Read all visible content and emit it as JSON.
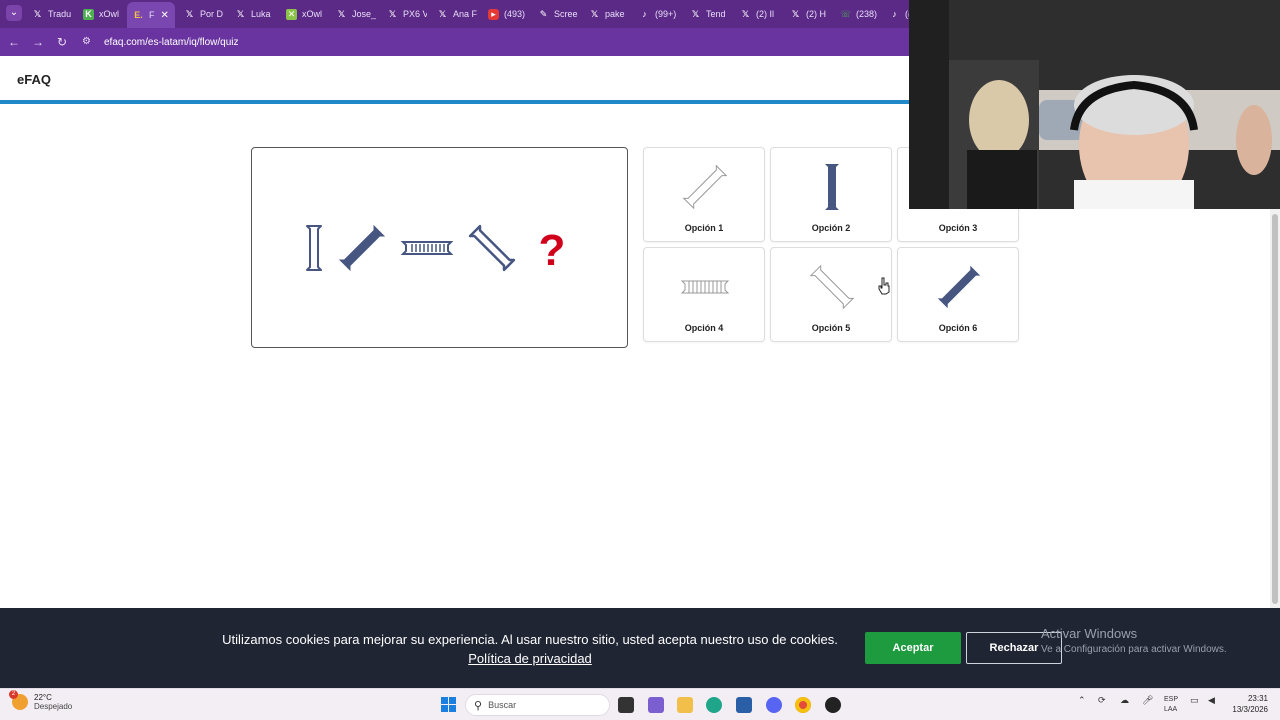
{
  "browser": {
    "tabs": [
      {
        "icon": "x-icon",
        "label": "Tradu"
      },
      {
        "icon": "xowl-icon",
        "label": "xOwl"
      },
      {
        "icon": "efaq-icon",
        "label": "F",
        "active": true
      },
      {
        "icon": "x-icon",
        "label": "Por D"
      },
      {
        "icon": "x-icon",
        "label": "Luka"
      },
      {
        "icon": "xowl-icon",
        "label": "xOwl"
      },
      {
        "icon": "x-icon",
        "label": "Jose_"
      },
      {
        "icon": "x-icon",
        "label": "PX6 V"
      },
      {
        "icon": "x-icon",
        "label": "Ana F"
      },
      {
        "icon": "youtube-icon",
        "label": "(493)"
      },
      {
        "icon": "screencast-icon",
        "label": "Scree"
      },
      {
        "icon": "x-icon",
        "label": "pake"
      },
      {
        "icon": "tiktok-icon",
        "label": "(99+)"
      },
      {
        "icon": "x-icon",
        "label": "Tend"
      },
      {
        "icon": "x-icon",
        "label": "(2) Il"
      },
      {
        "icon": "x-icon",
        "label": "(2) H"
      },
      {
        "icon": "whatsapp-icon",
        "label": "(238)"
      },
      {
        "icon": "tiktok-icon",
        "label": "(("
      }
    ],
    "url": "efaq.com/es-latam/iq/flow/quiz"
  },
  "site": {
    "logo": "eFAQ"
  },
  "quiz": {
    "question_mark": "?",
    "options": [
      {
        "label": "Opción 1"
      },
      {
        "label": "Opción 2"
      },
      {
        "label": "Opción 3"
      },
      {
        "label": "Opción 4"
      },
      {
        "label": "Opción 5"
      },
      {
        "label": "Opción 6"
      }
    ]
  },
  "cookie_banner": {
    "message": "Utilizamos cookies para mejorar su experiencia. Al usar nuestro sitio, usted acepta nuestro uso de cookies.",
    "policy_link": "Política de privacidad",
    "accept": "Aceptar",
    "reject": "Rechazar"
  },
  "windows_watermark": {
    "line1": "Activar Windows",
    "line2": "Ve a Configuración para activar Windows."
  },
  "taskbar": {
    "weather_temp": "22°C",
    "weather_desc": "Despejado",
    "weather_badge": "2",
    "search_placeholder": "Buscar",
    "lang_1": "ESP",
    "lang_2": "LAA",
    "time": "23:31",
    "date": "13/3/2026"
  },
  "colors": {
    "tabbar": "#5b2a86",
    "header_line": "#1e88c8",
    "shape_fill": "#475680",
    "question_mark": "#d0021b",
    "accept": "#1e9b3e",
    "banner": "#1f2533"
  }
}
